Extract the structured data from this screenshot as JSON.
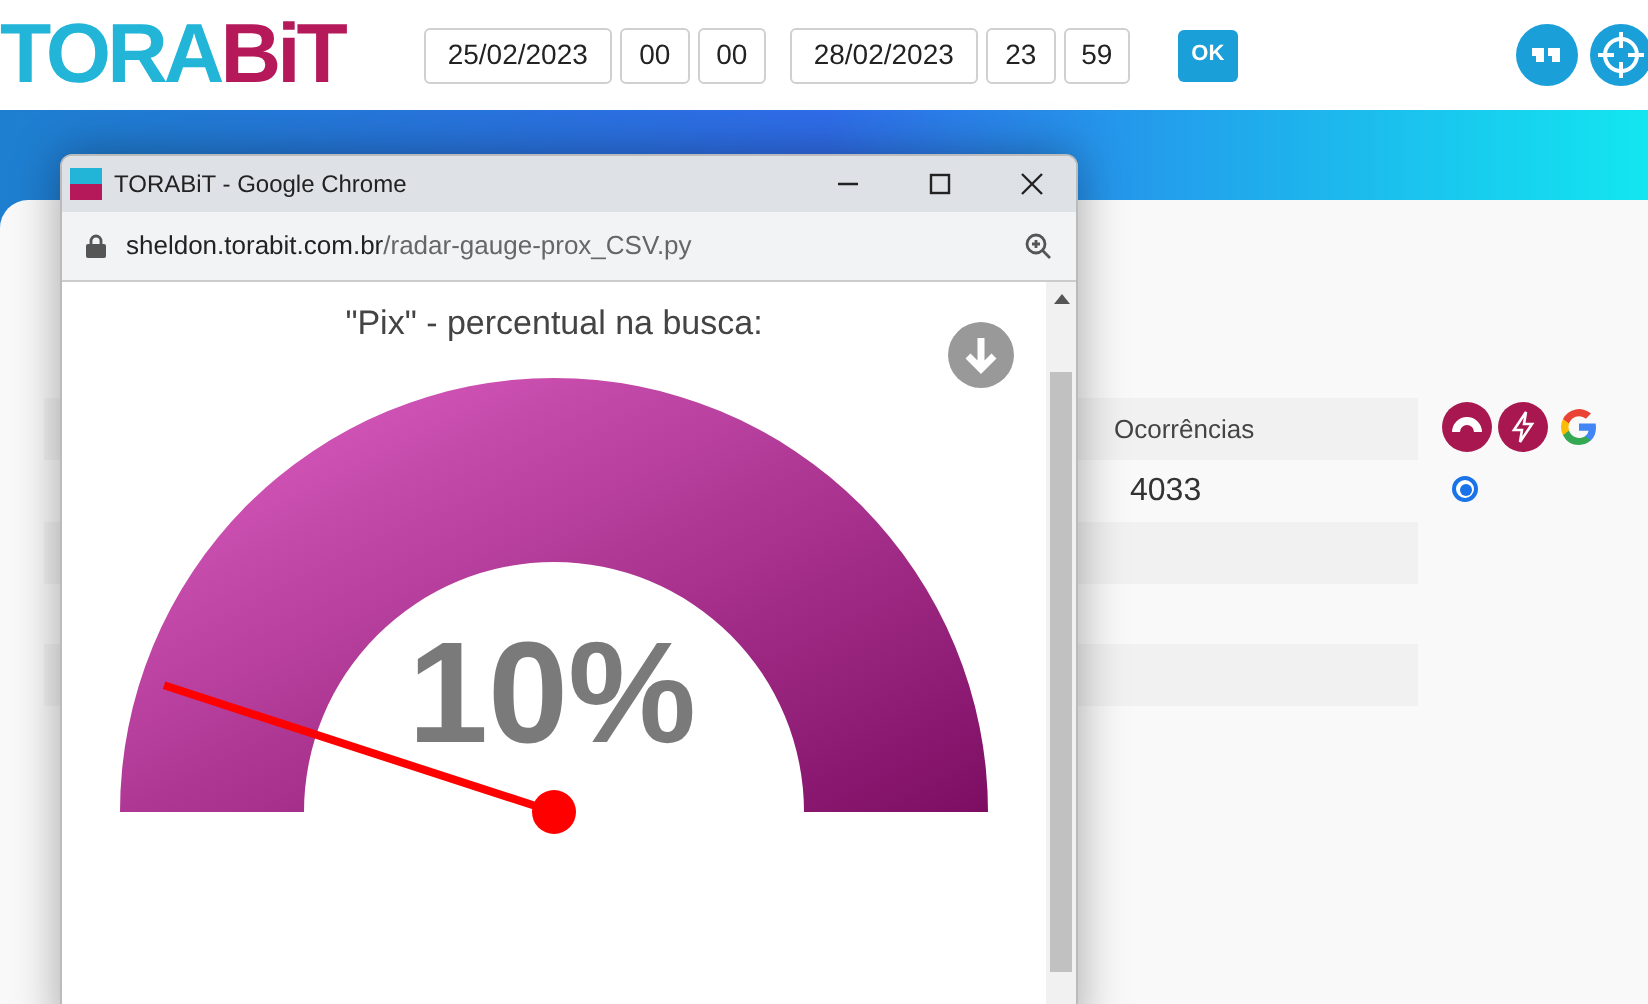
{
  "logo": {
    "part_1": "TORA",
    "part_2": "BiT"
  },
  "filters": {
    "start_date": "25/02/2023",
    "start_hour": "00",
    "start_minute": "00",
    "end_date": "28/02/2023",
    "end_hour": "23",
    "end_minute": "59",
    "ok_button": "OK"
  },
  "table": {
    "columns": [
      "Ocorrências"
    ],
    "rows": [
      {
        "cells": [
          "4033"
        ],
        "selected": true
      }
    ]
  },
  "popup": {
    "title": "TORABiT - Google Chrome",
    "url_host": "sheldon.torabit.com.br",
    "url_path": "/radar-gauge-prox_CSV.py",
    "gauge": {
      "title": "\"Pix\" - percentual na busca:",
      "reading": "10%",
      "level": 0.1
    }
  }
}
